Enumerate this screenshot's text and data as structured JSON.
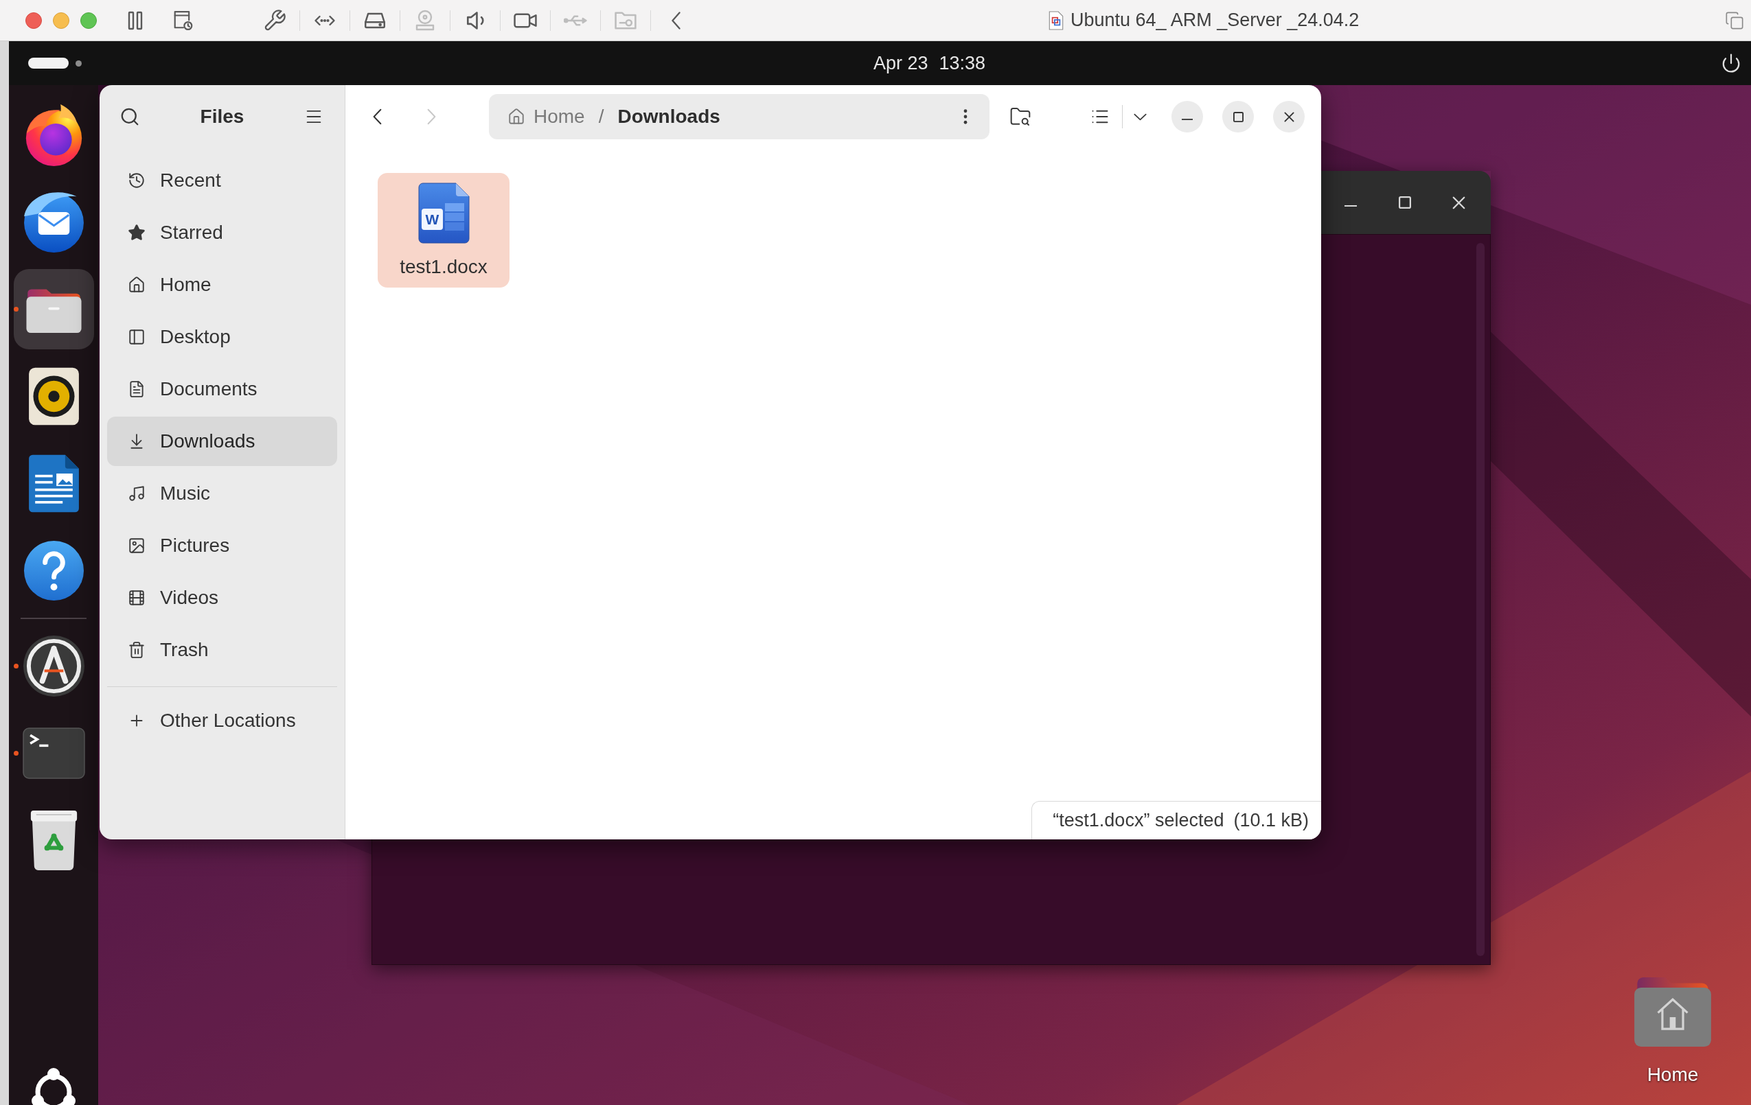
{
  "host_window": {
    "title": "Ubuntu 64_ ARM _Server _24.04.2",
    "toolbar": [
      {
        "kind": "pause",
        "disabled": false
      },
      {
        "kind": "snapshot",
        "disabled": false
      },
      {
        "kind": "settings",
        "disabled": false
      },
      {
        "kind": "network",
        "disabled": false
      },
      {
        "kind": "drive",
        "disabled": false
      },
      {
        "kind": "disc",
        "disabled": true
      },
      {
        "kind": "sound",
        "disabled": false
      },
      {
        "kind": "camera",
        "disabled": false
      },
      {
        "kind": "usb",
        "disabled": true
      },
      {
        "kind": "shared_folder",
        "disabled": true
      },
      {
        "kind": "collapse",
        "disabled": false
      }
    ]
  },
  "top_bar": {
    "date": "Apr 23",
    "time": "13:38"
  },
  "dock": {
    "sections": [
      {
        "items": [
          {
            "kind": "browser",
            "running": false,
            "focused": false
          },
          {
            "kind": "mail",
            "running": false,
            "focused": false
          },
          {
            "kind": "files",
            "running": true,
            "focused": true
          },
          {
            "kind": "music",
            "running": false,
            "focused": false
          },
          {
            "kind": "writer",
            "running": false,
            "focused": false
          },
          {
            "kind": "help",
            "running": false,
            "focused": false
          }
        ]
      },
      {
        "items": [
          {
            "kind": "updater",
            "running": true,
            "focused": false
          },
          {
            "kind": "terminal",
            "running": true,
            "focused": false
          },
          {
            "kind": "trash",
            "running": false,
            "focused": false
          }
        ]
      }
    ]
  },
  "files_window": {
    "title": "Files",
    "sidebar": [
      {
        "kind": "recent",
        "label": "Recent",
        "selected": false
      },
      {
        "kind": "starred",
        "label": "Starred",
        "selected": false
      },
      {
        "kind": "home",
        "label": "Home",
        "selected": false
      },
      {
        "kind": "desktop",
        "label": "Desktop",
        "selected": false
      },
      {
        "kind": "documents",
        "label": "Documents",
        "selected": false
      },
      {
        "kind": "downloads",
        "label": "Downloads",
        "selected": true
      },
      {
        "kind": "music",
        "label": "Music",
        "selected": false
      },
      {
        "kind": "pictures",
        "label": "Pictures",
        "selected": false
      },
      {
        "kind": "videos",
        "label": "Videos",
        "selected": false
      },
      {
        "kind": "trash",
        "label": "Trash",
        "selected": false
      }
    ],
    "other_locations": "Other Locations",
    "back": {
      "disabled": false
    },
    "forward": {
      "disabled": true
    },
    "path": {
      "separator": "/",
      "segments": [
        {
          "label": "Home",
          "selected": false
        },
        {
          "label": "Downloads",
          "selected": true
        }
      ]
    },
    "files": [
      {
        "name": "test1.docx",
        "icon_label": "W",
        "selected": true
      }
    ],
    "status": {
      "selection": "“test1.docx” selected",
      "size": "(10.1 kB)"
    }
  },
  "desktop_icons": [
    {
      "label": "Home"
    }
  ]
}
